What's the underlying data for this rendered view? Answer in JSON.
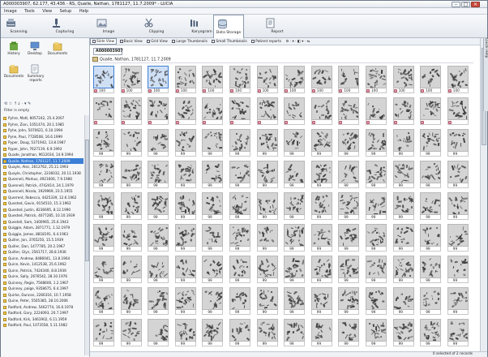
{
  "window": {
    "title": "A000003907, 62.177, 43.436 - RS, Quaile, Nathan, 1781127, 11.7.2009* - LUCIA",
    "minimize": "–",
    "maximize": "□",
    "close": "×"
  },
  "menu": [
    "Image",
    "Tools",
    "View",
    "Setup",
    "Help"
  ],
  "modes": [
    {
      "label": "Scanning",
      "icon": "scanner-icon"
    },
    {
      "label": "Capturing",
      "icon": "microscope-icon"
    },
    {
      "label": "Image",
      "icon": "image-icon"
    },
    {
      "label": "Clipping",
      "icon": "clipping-icon"
    },
    {
      "label": "Karyogram",
      "icon": "karyogram-icon"
    },
    {
      "label": "Data Storage",
      "icon": "database-icon"
    },
    {
      "label": "Report",
      "icon": "report-icon"
    }
  ],
  "left_panel": {
    "buttons": [
      {
        "label": "History",
        "icon": "history-icon"
      },
      {
        "label": "Desktop",
        "icon": "desktop-icon"
      },
      {
        "label": "Documents",
        "icon": "documents-icon"
      },
      {
        "label": "Documents",
        "icon": "documents-icon"
      },
      {
        "label": "Summary reports",
        "icon": "summary-reports-icon"
      }
    ],
    "tools_text": "⟲ ☆ ↑↓ · ▾ ✎",
    "filter_label": "Filter is empty",
    "patients": [
      "Pyhre, Matt, 8057242, 25.4.2007",
      "Pyhre, Zion, 1051474, 20.1.1985",
      "Pyhe, John, 5070621, 6.10.1994",
      "Pyne, Paul, 7728508, 16.6.1999",
      "Pyper, Doug, 5371942, 13.8.1987",
      "Pyper, John, 7627119, 6.9.1993",
      "Quade, Jonathan, 9612034, 14.9.1994",
      "Quaile, Nathan, 1781127, 11.7.2009",
      "Quayle, Alec, 2612762, 25.11.1993",
      "Quayle, Christopher, 2236032, 20.11.1938",
      "Quenneli, Markus, 4921606, 7.9.1980",
      "Quennell, Patrick, 4742414, 24.1.1979",
      "Quennell, Nicola, 1929969, 23.5.1955",
      "Querrent, Rebecca, 4425339, 12.6.1962",
      "Quested, Gavin, 9154510, 15.3.1962",
      "Quested, Justin, 8236695, 8.12.1990",
      "Quested, Patrick, 4077285, 10.10.1939",
      "Questell, Sam, 1400965, 25.6.1943",
      "Quiggie, Adam, 2871771, 1.12.1979",
      "Quiggie, James, 8818191, 6.4.1963",
      "Quiller, Jon, 3765250, 15.5.1939",
      "Quiller, Dan, 1477785, 20.2.1967",
      "Quilter, Glyn, 2561717, 28.8.1936",
      "Quinn, Andrew, 8486041, 13.8.1964",
      "Quinn, Kevin, 1412538, 25.6.1962",
      "Quinn, Patrick, 7424340, 8.8.1936",
      "Quinn, Sally, 2676542, 28.10.1976",
      "Quinney, Regie, 7568600, 1.2.1967",
      "Quinney, paige, 9358675, 6.4.1997",
      "Quirke, Duncan, 2266316, 10.7.1958",
      "Quine, Peter, 5505385, 28.10.2006",
      "Radford, Andrew, 5462774, 16.6.1978",
      "Radford, Gary, 2224093, 20.7.1997",
      "Radford, Kirk, 3461902, 6.11.1959",
      "Radford, Paul, 1073558, 5.11.1982"
    ],
    "selected_index": 7
  },
  "view_bar": {
    "slide_view": "Slide View",
    "basic_view": "Basic View",
    "grid_view": "Grid View",
    "large_thumbnails": "Large Thumbnails",
    "small_thumbnails": "Small Thumbnails",
    "patient_reports": "Patient reports",
    "extra_tools": "⚙ · ▾ · ◧ ▾ · ⇆"
  },
  "case_id": "A000003907",
  "patient_header": "Quaile, Nathan, 1781127, 11.7.2009",
  "grid": {
    "columns": 14,
    "rows": 9,
    "captions_by_row": [
      "100",
      "",
      "99",
      "99",
      "99",
      "99",
      "99",
      "99",
      "99"
    ],
    "tag_first_n_rows": 2,
    "selected": [
      0,
      2
    ]
  },
  "status": {
    "selection": "0 selected of 2 records"
  },
  "quick_help": "Quick Help",
  "colors": {
    "selection": "#3c7fd6",
    "tag": "#e69aa8"
  }
}
